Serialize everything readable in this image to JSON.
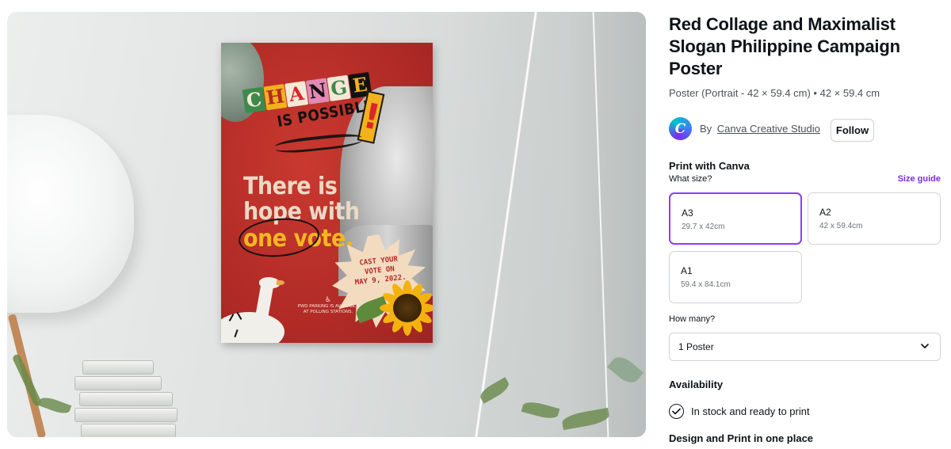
{
  "mockup": {
    "poster": {
      "headline_letters": [
        "C",
        "H",
        "A",
        "N",
        "G",
        "E"
      ],
      "headline_sub": "IS POSSIBLE.",
      "exclaim": "!",
      "hope_lines": [
        "There is",
        "hope with",
        "one vote."
      ],
      "cast_lines": [
        "CAST YOUR",
        "VOTE ON",
        "MAY 9, 2022."
      ],
      "parking_lines": [
        "PWD PARKING IS AVAILABLE",
        "AT POLLING STATIONS."
      ]
    }
  },
  "product": {
    "title_lines": [
      "Red Collage and Maximalist",
      "Slogan Philippine Campaign",
      "Poster"
    ],
    "subtitle": "Poster (Portrait - 42 × 59.4 cm) • 42 × 59.4 cm",
    "creator_prefix": "By",
    "creator_name": "Canva Creative Studio",
    "avatar_letter": "C",
    "follow_label": "Follow"
  },
  "print": {
    "section_title": "Print with Canva",
    "size_label": "What size?",
    "size_guide": "Size guide",
    "sizes": [
      {
        "name": "A3",
        "dims": "29.7 x 42cm",
        "selected": true
      },
      {
        "name": "A2",
        "dims": "42 x 59.4cm",
        "selected": false
      },
      {
        "name": "A1",
        "dims": "59.4 x 84.1cm",
        "selected": false
      }
    ],
    "qty_label": "How many?",
    "qty_value": "1 Poster",
    "availability_title": "Availability",
    "availability_text": "In stock and ready to print",
    "design_print_title": "Design and Print in one place"
  },
  "colors": {
    "accent": "#8b3dff",
    "size_guide": "#7d2ae8",
    "poster_red": "#b22b27",
    "poster_yellow": "#f3b623"
  }
}
